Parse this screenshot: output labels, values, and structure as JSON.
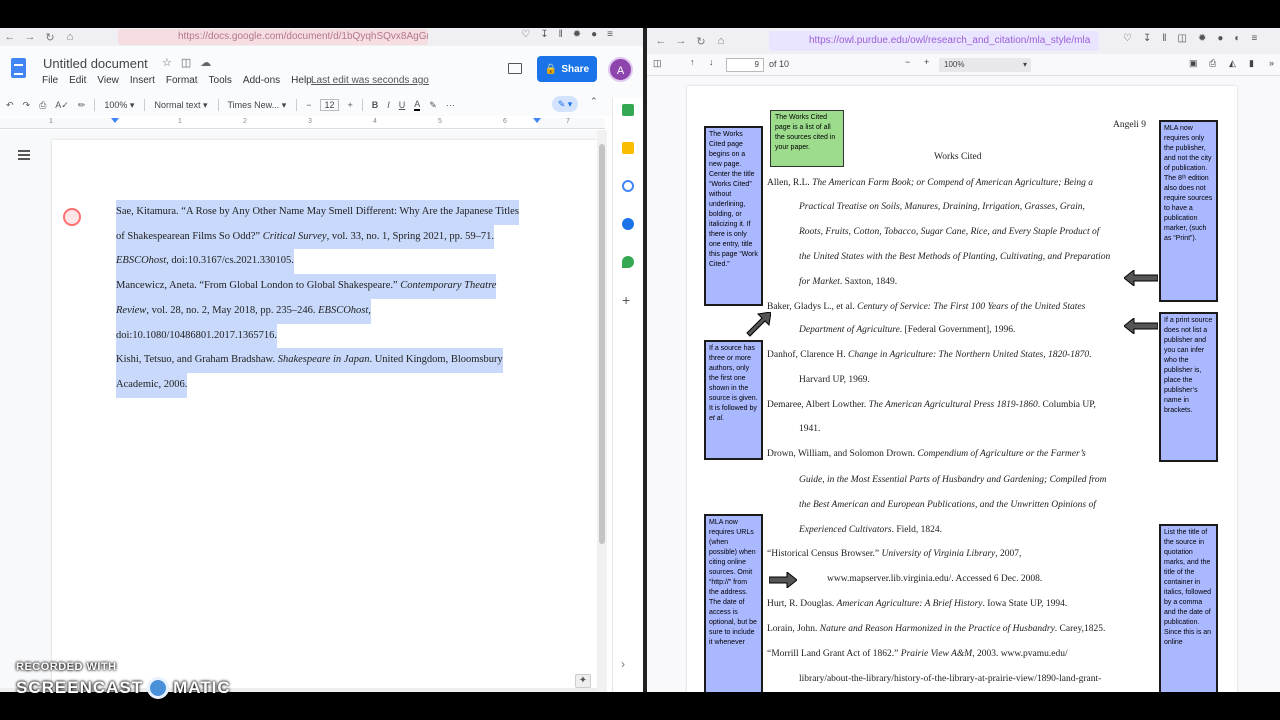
{
  "left_browser": {
    "url": "https://docs.google.com/document/d/1bQyqhSQvx8AgGn"
  },
  "docs": {
    "title": "Untitled document",
    "menu": [
      "File",
      "Edit",
      "View",
      "Insert",
      "Format",
      "Tools",
      "Add-ons",
      "Help"
    ],
    "last_edit": "Last edit was seconds ago",
    "share_label": "Share",
    "avatar_initial": "A",
    "zoom": "100%",
    "style": "Normal text",
    "font": "Times New...",
    "font_size": "12",
    "ruler_numbers": [
      "1",
      "1",
      "2",
      "3",
      "4",
      "5",
      "6",
      "7"
    ],
    "entries": [
      {
        "lines": [
          "Sae, Kitamura. “A Rose by Any Other Name May Smell Different: Why Are the Japanese Titles",
          "of Shakespearean Films So Odd?” ",
          "EBSCOhost",
          ", doi:10.3167/cs.2021.330105."
        ],
        "italic_1": "Critical Survey",
        "rest_1": ", vol. 33, no. 1, Spring 2021, pp. 59–71."
      },
      {
        "a": "Mancewicz, Aneta. “From Global London to Global Shakespeare.” ",
        "b": "Contemporary Theatre",
        "c": "Review",
        "d": ", vol. 28, no. 2, May 2018, pp. 235–246. ",
        "e": "EBSCOhost,",
        "f": "doi:10.1080/10486801.2017.1365716."
      },
      {
        "a": "Kishi, Tetsuo, and Graham Bradshaw. ",
        "b": "Shakespeare in Japan",
        "c": ". United Kingdom, Bloomsbury",
        "d": "Academic, 2006."
      }
    ]
  },
  "watermark": {
    "line1": "RECORDED WITH",
    "line2a": "SCREENCAST",
    "line2b": "MATIC"
  },
  "right_browser": {
    "url": "https://owl.purdue.edu/owl/research_and_citation/mla_style/mla",
    "page_current": "9",
    "page_total": "of 10",
    "zoom": "100%"
  },
  "pdf": {
    "running_head": "Angeli 9",
    "heading": "Works Cited",
    "lines": [
      {
        "t1": "Allen, R.L. ",
        "i1": "The American Farm Book; or Compend of American Agriculture; Being a"
      },
      {
        "i1": "Practical Treatise on Soils, Manures, Draining, Irrigation, Grasses, Grain,"
      },
      {
        "i1": "Roots, Fruits, Cotton, Tobacco, Sugar Cane, Rice, and Every Staple Product of"
      },
      {
        "i1": "the United States with the Best Methods of Planting, Cultivating, and Preparation"
      },
      {
        "i1": "for Market",
        "t2": ". Saxton, 1849."
      },
      {
        "t1": "Baker, Gladys L., et al. ",
        "i1": "Century of Service: The First 100 Years of the United States"
      },
      {
        "i1": "Department of Agriculture",
        "t2": ". [Federal Government], 1996."
      },
      {
        "t1": "Danhof, Clarence H. ",
        "i1": "Change in Agriculture: The Northern United States, 1820-1870",
        "t2": "."
      },
      {
        "t1": "Harvard UP, 1969."
      },
      {
        "t1": "Demaree, Albert Lowther. ",
        "i1": "The American Agricultural Press 1819-1860",
        "t2": ". Columbia UP,"
      },
      {
        "t1": "1941."
      },
      {
        "t1": "Drown, William, and Solomon Drown. ",
        "i1": "Compendium of Agriculture or the Farmer’s"
      },
      {
        "i1": "Guide, in the Most Essential Parts of Husbandry and Gardening; Compiled from"
      },
      {
        "i1": "the Best American and European Publications, and the Unwritten Opinions of"
      },
      {
        "i1": "Experienced Cultivators",
        "t2": ". Field, 1824."
      },
      {
        "t1": "“Historical Census Browser.” ",
        "i1": "University of Virginia Library",
        "t2": ", 2007,"
      },
      {
        "t1": "www.mapserver.lib.virginia.edu/. Accessed 6 Dec. 2008."
      },
      {
        "t1": "Hurt, R. Douglas. ",
        "i1": "American Agriculture: A Brief History",
        "t2": ". Iowa State UP, 1994."
      },
      {
        "t1": "Lorain, John. ",
        "i1": "Nature and Reason Harmonized in the Practice of Husbandry",
        "t2": ". Carey,1825."
      },
      {
        "t1": "“Morrill Land Grant Act of 1862.” ",
        "i1": "Prairie View A&M",
        "t2": ", 2003. www.pvamu.edu/"
      },
      {
        "t1": "library/about-the-library/history-of-the-library-at-prairie-view/1890-land-grant-"
      }
    ],
    "callouts": {
      "green": "The Works Cited page is a list of all the sources cited in your paper.",
      "left1": "The Works Cited page begins on a new page. Center the title “Works Cited” without underlining, bolding, or italicizing it. If there is only one entry, title this page “Work Cited.”",
      "left2a": "If a source has three or more authors, only the first one shown in the source is given. It is followed by ",
      "left2b": "et al.",
      "left3": "MLA now requires URLs (when possible) when citing online sources. Omit “http://” from the address. The date of access is optional, but be sure to include it whenever",
      "right1": "MLA now requires only the publisher, and not the city of publication. The 8ᵗʰ edition also does not require sources to have a publication marker, (such as “Print”).",
      "right2": "If a print source does not list a publisher and you can infer who the publisher is, place the publisher’s name in brackets.",
      "right3": "List the title of the source in quotation marks, and the title of the container in italics, followed by a comma and the date of publication. Since this is an online"
    }
  }
}
